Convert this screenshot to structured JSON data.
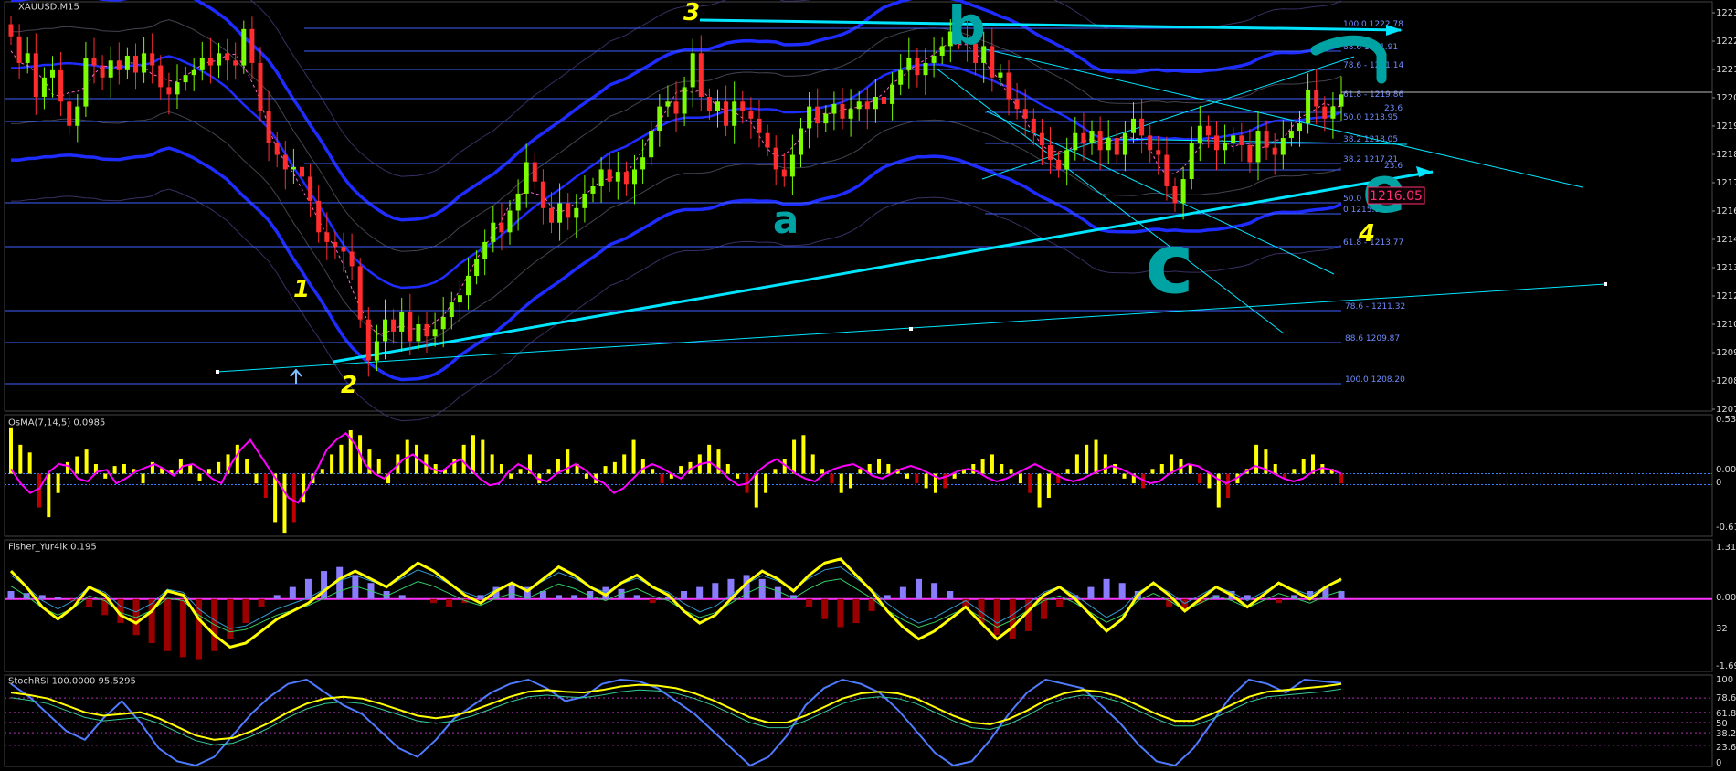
{
  "window": {
    "title": "XAUUSD,M15",
    "icon_name": "chart-window-icon"
  },
  "colors": {
    "background": "#000000",
    "grid": "#2a2a2a",
    "bull": "#7CFC00",
    "bear": "#FF2D2D",
    "band": "#1f2cff",
    "trend": "#00E5FF",
    "fib": "#3f5fff",
    "wave_label": "#FFFF00",
    "hand_drawn": "#00A3A3",
    "osma_pos": "#FFFF00",
    "osma_neg": "#C00000",
    "osma_line": "#FF00FF",
    "fisher_pos": "#8A7CFF",
    "fisher_neg": "#9A0000",
    "fisher_line": "#FFFF00",
    "stoch_main": "#4F7BFF",
    "stoch_signal": "#FFFF00",
    "price_box": "#FF3070"
  },
  "main_chart": {
    "price_axis": [
      "1223",
      "1222",
      "1221",
      "1220",
      "1219",
      "1218",
      "1217",
      "1216",
      "1214",
      "1213",
      "1212",
      "1210",
      "1209",
      "1208",
      "1207"
    ],
    "current_price": "1216.05",
    "wave_labels": [
      "1",
      "2",
      "3",
      "4"
    ],
    "hand_labels": [
      "b",
      "a",
      "c",
      "e"
    ],
    "fib_upper": [
      "100.0 1222.78",
      "88.6 1221.91",
      "78.6 - 1221.14",
      "61.8 - 1219.86",
      "23.6",
      "50.0 1218.95",
      "38.2 1218.05",
      "38.2 1217.21",
      "23.6",
      "50.0",
      "0 1215.12",
      "61.8 - 1213.77"
    ],
    "fib_lower": [
      "78.6 - 1211.32",
      "88.6 1209.87",
      "100.0 1208.20"
    ],
    "chart_data": {
      "type": "candlestick",
      "title": "XAUUSD,M15",
      "ylim": [
        1207,
        1223.5
      ],
      "close": [
        1222.3,
        1221.2,
        1221.6,
        1219.8,
        1220.6,
        1220.9,
        1219.6,
        1218.6,
        1219.4,
        1221.4,
        1221.1,
        1220.6,
        1221.3,
        1220.9,
        1221.5,
        1220.8,
        1221.6,
        1221.1,
        1220.2,
        1219.9,
        1220.4,
        1220.7,
        1220.9,
        1221.4,
        1221.1,
        1221.6,
        1221.3,
        1221.1,
        1222.6,
        1221.2,
        1219.2,
        1217.9,
        1217.4,
        1216.8,
        1216.9,
        1216.5,
        1215.5,
        1214.2,
        1213.8,
        1213.6,
        1213.4,
        1212.8,
        1210.6,
        1208.9,
        1209.7,
        1210.6,
        1210.1,
        1210.9,
        1209.7,
        1210.4,
        1209.9,
        1210.2,
        1210.7,
        1211.3,
        1211.6,
        1212.4,
        1213.1,
        1213.8,
        1214.6,
        1214.2,
        1215.1,
        1215.8,
        1217.1,
        1216.3,
        1215.2,
        1214.6,
        1215.4,
        1214.8,
        1215.2,
        1215.8,
        1216.1,
        1216.8,
        1216.3,
        1216.7,
        1216.2,
        1216.8,
        1217.3,
        1218.4,
        1219.4,
        1219.6,
        1219.1,
        1220.2,
        1221.6,
        1219.8,
        1219.2,
        1219.6,
        1218.6,
        1219.6,
        1219.2,
        1218.9,
        1218.3,
        1217.7,
        1216.8,
        1216.5,
        1217.4,
        1218.5,
        1219.4,
        1218.7,
        1219.1,
        1219.5,
        1218.9,
        1219.3,
        1219.6,
        1219.3,
        1219.8,
        1219.5,
        1220.3,
        1220.9,
        1221.4,
        1220.7,
        1221.2,
        1221.5,
        1221.9,
        1222.5,
        1222.2,
        1222.0,
        1221.2,
        1221.9,
        1220.6,
        1220.8,
        1219.7,
        1219.3,
        1218.9,
        1218.3,
        1217.8,
        1217.2,
        1216.8,
        1217.6,
        1218.3,
        1217.9,
        1218.4,
        1217.6,
        1218.1,
        1217.4,
        1218.3,
        1218.9,
        1218.2,
        1217.6,
        1217.4,
        1216.1,
        1215.4,
        1216.4,
        1217.9,
        1218.6,
        1218.2,
        1217.6,
        1217.9,
        1218.2,
        1217.8,
        1217.1,
        1218.4,
        1217.7,
        1217.4,
        1218.1,
        1218.4,
        1218.7,
        1220.1,
        1219.4,
        1218.9,
        1219.4,
        1219.9
      ]
    }
  },
  "osma": {
    "title": "OsMA(7,14,5) 0.0985",
    "axis": [
      "0.535",
      "0.00",
      "0",
      "-0.619"
    ],
    "chart_data": {
      "type": "bar",
      "series": [
        {
          "name": "OsMA(7,14,5)",
          "values": [
            0.48,
            0.3,
            0.22,
            -0.35,
            -0.45,
            -0.2,
            0.12,
            0.18,
            0.25,
            0.1,
            -0.05,
            0.08,
            0.1,
            0.05,
            -0.1,
            0.12,
            0.06,
            0.04,
            0.15,
            0.1,
            -0.08,
            0.05,
            0.12,
            0.2,
            0.3,
            0.15,
            -0.1,
            -0.25,
            -0.5,
            -0.62,
            -0.5,
            -0.3,
            -0.1,
            0.05,
            0.2,
            0.3,
            0.45,
            0.4,
            0.25,
            0.15,
            -0.1,
            0.2,
            0.35,
            0.3,
            0.2,
            0.1,
            0.05,
            0.15,
            0.3,
            0.4,
            0.35,
            0.2,
            0.1,
            -0.05,
            0.05,
            0.2,
            -0.1,
            0.05,
            0.15,
            0.25,
            0.1,
            -0.05,
            -0.1,
            0.08,
            0.12,
            0.2,
            0.35,
            0.15,
            0.05,
            -0.1,
            -0.05,
            0.08,
            0.12,
            0.2,
            0.3,
            0.25,
            0.1,
            -0.05,
            -0.2,
            -0.35,
            -0.2,
            0.05,
            0.15,
            0.35,
            0.4,
            0.2,
            0.05,
            -0.1,
            -0.2,
            -0.15,
            0.05,
            0.1,
            0.15,
            0.1,
            0.05,
            -0.05,
            -0.1,
            -0.15,
            -0.2,
            -0.15,
            -0.05,
            0.05,
            0.1,
            0.15,
            0.2,
            0.1,
            0.05,
            -0.1,
            -0.2,
            -0.35,
            -0.25,
            -0.1,
            0.05,
            0.2,
            0.3,
            0.35,
            0.2,
            0.1,
            -0.05,
            -0.1,
            -0.15,
            0.05,
            0.1,
            0.2,
            0.15,
            0.1,
            -0.1,
            -0.15,
            -0.35,
            -0.25,
            -0.1,
            0.05,
            0.3,
            0.25,
            0.1,
            -0.05,
            0.05,
            0.15,
            0.2,
            0.1,
            0.05,
            -0.1
          ]
        },
        {
          "name": "signal",
          "values": [
            0.05,
            -0.1,
            -0.2,
            -0.15,
            0.02,
            0.1,
            0.08,
            -0.05,
            -0.08,
            0.02,
            0.04,
            -0.1,
            -0.05,
            0.02,
            0.06,
            0.1,
            0.05,
            -0.02,
            0.08,
            0.1,
            0.04,
            -0.05,
            -0.1,
            0.1,
            0.25,
            0.35,
            0.2,
            0.05,
            -0.1,
            -0.25,
            -0.3,
            -0.15,
            0.05,
            0.25,
            0.35,
            0.42,
            0.3,
            0.1,
            0.0,
            -0.05,
            0.05,
            0.15,
            0.2,
            0.12,
            0.05,
            0.02,
            0.1,
            0.15,
            0.05,
            -0.05,
            -0.12,
            -0.1,
            0.02,
            0.1,
            0.05,
            -0.05,
            -0.08,
            0.0,
            0.05,
            0.1,
            0.04,
            -0.05,
            -0.1,
            -0.2,
            -0.15,
            -0.05,
            0.05,
            0.1,
            0.06,
            0.0,
            -0.05,
            0.05,
            0.1,
            0.12,
            0.05,
            -0.05,
            -0.12,
            -0.1,
            0.02,
            0.1,
            0.15,
            0.08,
            0.0,
            -0.05,
            -0.08,
            0.0,
            0.05,
            0.08,
            0.1,
            0.05,
            -0.02,
            -0.05,
            0.0,
            0.05,
            0.08,
            0.05,
            0.0,
            -0.05,
            -0.02,
            0.03,
            0.05,
            0.02,
            -0.04,
            -0.08,
            -0.05,
            0.0,
            0.05,
            0.1,
            0.05,
            0.0,
            -0.05,
            -0.08,
            -0.05,
            0.0,
            0.04,
            0.08,
            0.05,
            0.0,
            -0.05,
            -0.1,
            -0.08,
            0.0,
            0.05,
            0.1,
            0.08,
            0.02,
            -0.05,
            -0.1,
            -0.05,
            0.02,
            0.08,
            0.05,
            0.0,
            -0.05,
            -0.08,
            -0.05,
            0.02,
            0.06,
            0.04,
            0.0
          ]
        }
      ],
      "ylim": [
        -0.619,
        0.535
      ]
    }
  },
  "fisher": {
    "title": "Fisher_Yur4ik 0.195",
    "axis": [
      "1.317",
      "0.00",
      "32",
      "-1.692"
    ],
    "chart_data": {
      "type": "bar",
      "series": [
        {
          "name": "Fisher_Yur4ik",
          "values": [
            0.2,
            0.15,
            0.1,
            0.05,
            -0.05,
            -0.2,
            -0.4,
            -0.6,
            -0.9,
            -1.1,
            -1.3,
            -1.45,
            -1.5,
            -1.3,
            -1.0,
            -0.6,
            -0.2,
            0.1,
            0.3,
            0.5,
            0.7,
            0.8,
            0.6,
            0.4,
            0.2,
            0.1,
            0.0,
            -0.1,
            -0.2,
            -0.1,
            0.1,
            0.3,
            0.4,
            0.3,
            0.2,
            0.1,
            0.1,
            0.2,
            0.3,
            0.25,
            0.1,
            -0.1,
            0.05,
            0.2,
            0.3,
            0.4,
            0.5,
            0.6,
            0.5,
            0.3,
            0.1,
            -0.2,
            -0.5,
            -0.7,
            -0.6,
            -0.3,
            0.1,
            0.3,
            0.5,
            0.4,
            0.2,
            -0.2,
            -0.6,
            -0.9,
            -1.0,
            -0.8,
            -0.5,
            -0.2,
            0.1,
            0.3,
            0.5,
            0.4,
            0.2,
            0.0,
            -0.2,
            -0.3,
            -0.1,
            0.1,
            0.2,
            0.1,
            0.0,
            -0.1,
            0.1,
            0.2,
            0.3,
            0.2
          ]
        },
        {
          "name": "signal",
          "values": [
            0.7,
            0.3,
            -0.2,
            -0.5,
            -0.2,
            0.3,
            0.1,
            -0.4,
            -0.6,
            -0.3,
            0.2,
            0.1,
            -0.5,
            -0.9,
            -1.2,
            -1.1,
            -0.8,
            -0.5,
            -0.3,
            -0.1,
            0.2,
            0.5,
            0.7,
            0.5,
            0.3,
            0.6,
            0.9,
            0.7,
            0.4,
            0.1,
            -0.1,
            0.2,
            0.4,
            0.2,
            0.5,
            0.8,
            0.6,
            0.3,
            0.1,
            0.4,
            0.6,
            0.3,
            0.1,
            -0.3,
            -0.6,
            -0.4,
            0.0,
            0.4,
            0.7,
            0.5,
            0.2,
            0.6,
            0.9,
            1.0,
            0.6,
            0.2,
            -0.3,
            -0.7,
            -1.0,
            -0.8,
            -0.5,
            -0.2,
            -0.6,
            -1.0,
            -0.7,
            -0.3,
            0.1,
            0.3,
            0.0,
            -0.4,
            -0.8,
            -0.5,
            0.1,
            0.4,
            0.1,
            -0.3,
            0.0,
            0.3,
            0.1,
            -0.2,
            0.1,
            0.4,
            0.2,
            0.0,
            0.3,
            0.5
          ]
        }
      ],
      "ylim": [
        -1.692,
        1.317
      ]
    }
  },
  "stochrsi": {
    "title": "StochRSI 100.0000 95.5295",
    "axis": [
      "100",
      "78.6",
      "61.8",
      "50",
      "38.2",
      "23.6",
      "0"
    ],
    "chart_data": {
      "type": "line",
      "series": [
        {
          "name": "StochRSI",
          "values": [
            95,
            80,
            60,
            40,
            30,
            55,
            75,
            50,
            20,
            5,
            0,
            10,
            35,
            60,
            80,
            95,
            100,
            85,
            70,
            60,
            40,
            20,
            10,
            30,
            55,
            70,
            85,
            95,
            100,
            90,
            75,
            80,
            95,
            100,
            98,
            90,
            75,
            60,
            40,
            20,
            0,
            10,
            35,
            70,
            90,
            100,
            95,
            85,
            65,
            40,
            15,
            0,
            5,
            30,
            60,
            85,
            100,
            95,
            90,
            70,
            50,
            25,
            5,
            0,
            20,
            50,
            80,
            100,
            95,
            85,
            100,
            98,
            96
          ]
        },
        {
          "name": "signal",
          "values": [
            85,
            82,
            78,
            70,
            62,
            58,
            60,
            62,
            55,
            45,
            35,
            30,
            32,
            40,
            50,
            62,
            72,
            78,
            80,
            78,
            72,
            65,
            58,
            55,
            58,
            64,
            72,
            80,
            86,
            88,
            86,
            85,
            88,
            92,
            94,
            93,
            90,
            84,
            76,
            66,
            56,
            50,
            50,
            58,
            68,
            78,
            84,
            86,
            84,
            78,
            68,
            58,
            50,
            48,
            54,
            64,
            76,
            84,
            88,
            86,
            80,
            70,
            60,
            52,
            52,
            60,
            70,
            80,
            86,
            88,
            90,
            92,
            95
          ]
        }
      ],
      "ylim": [
        0,
        100
      ]
    }
  }
}
